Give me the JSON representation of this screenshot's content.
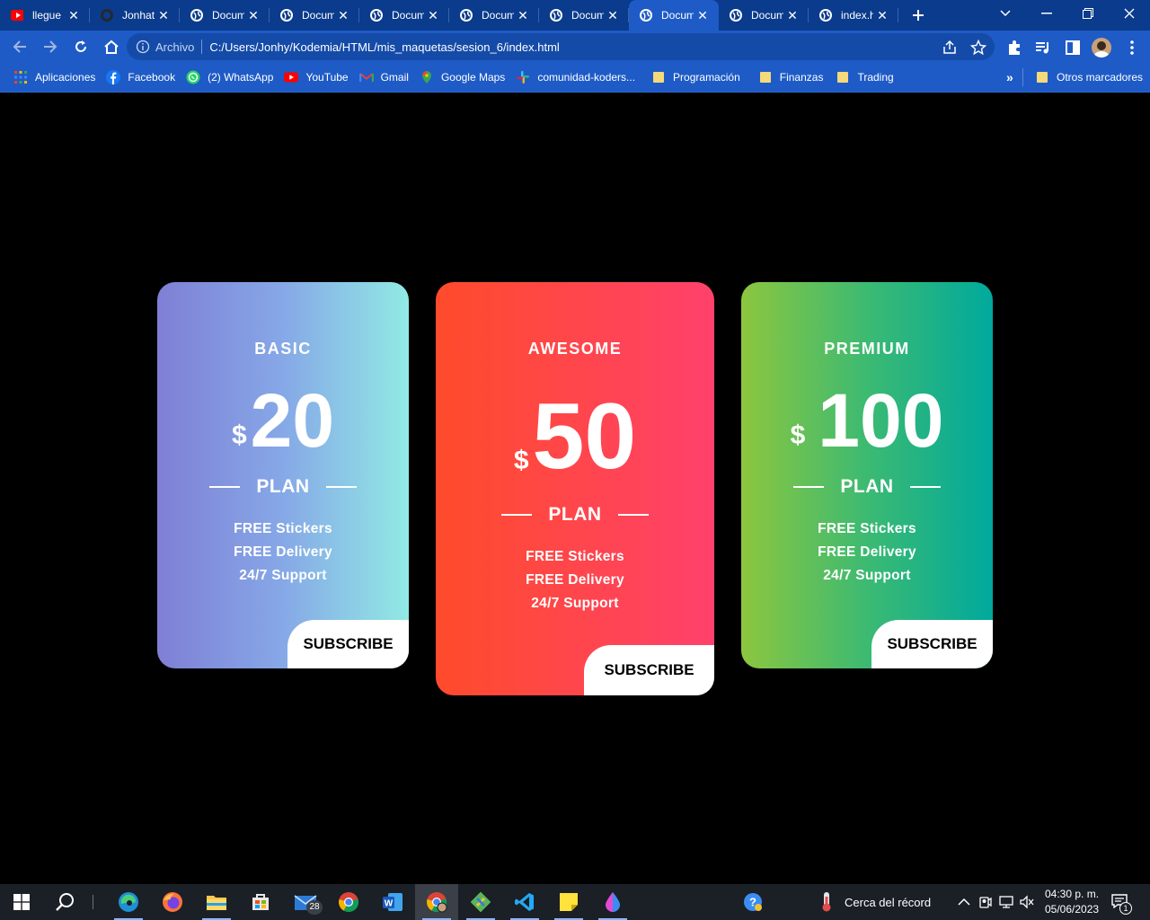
{
  "browser": {
    "tabs": [
      {
        "title": "llegue a",
        "icon": "youtube-icon"
      },
      {
        "title": "Jonhat",
        "icon": "github-icon"
      },
      {
        "title": "Docum",
        "icon": "globe-icon"
      },
      {
        "title": "Docum",
        "icon": "globe-icon"
      },
      {
        "title": "Docum",
        "icon": "globe-icon"
      },
      {
        "title": "Docum",
        "icon": "globe-icon"
      },
      {
        "title": "Docum",
        "icon": "globe-icon"
      },
      {
        "title": "Docum",
        "icon": "globe-icon",
        "active": true
      },
      {
        "title": "Docum",
        "icon": "globe-icon"
      },
      {
        "title": "index.h",
        "icon": "globe-icon"
      }
    ],
    "address": {
      "label": "Archivo",
      "url": "C:/Users/Jonhy/Kodemia/HTML/mis_maquetas/sesion_6/index.html"
    },
    "bookmarks": [
      {
        "label": "Aplicaciones",
        "icon": "apps-grid-icon"
      },
      {
        "label": "Facebook",
        "icon": "facebook-icon"
      },
      {
        "label": "(2) WhatsApp",
        "icon": "whatsapp-icon"
      },
      {
        "label": "YouTube",
        "icon": "youtube-icon"
      },
      {
        "label": "Gmail",
        "icon": "gmail-icon"
      },
      {
        "label": "Google Maps",
        "icon": "maps-icon"
      },
      {
        "label": "comunidad-koders...",
        "icon": "slack-icon"
      },
      {
        "label": "Programación",
        "icon": "folder-icon"
      },
      {
        "label": "Finanzas",
        "icon": "folder-icon"
      },
      {
        "label": "Trading",
        "icon": "folder-icon"
      }
    ],
    "more_bookmarks": "»",
    "other_bookmarks": "Otros marcadores"
  },
  "pricing": {
    "cards": [
      {
        "name": "BASIC",
        "currency": "$",
        "amount": "20",
        "plan_label": "PLAN",
        "features": [
          "FREE Stickers",
          "FREE Delivery",
          "24/7 Support"
        ],
        "cta": "SUBSCRIBE"
      },
      {
        "name": "AWESOME",
        "currency": "$",
        "amount": "50",
        "plan_label": "PLAN",
        "features": [
          "FREE Stickers",
          "FREE Delivery",
          "24/7 Support"
        ],
        "cta": "SUBSCRIBE"
      },
      {
        "name": "PREMIUM",
        "currency": "$",
        "amount": "100",
        "plan_label": "PLAN",
        "features": [
          "FREE Stickers",
          "FREE Delivery",
          "24/7 Support"
        ],
        "cta": "SUBSCRIBE"
      }
    ]
  },
  "taskbar": {
    "mail_badge": "28",
    "weather": "Cerca del récord",
    "time": "04:30 p. m.",
    "date": "05/06/2023",
    "notification_count": "1"
  }
}
